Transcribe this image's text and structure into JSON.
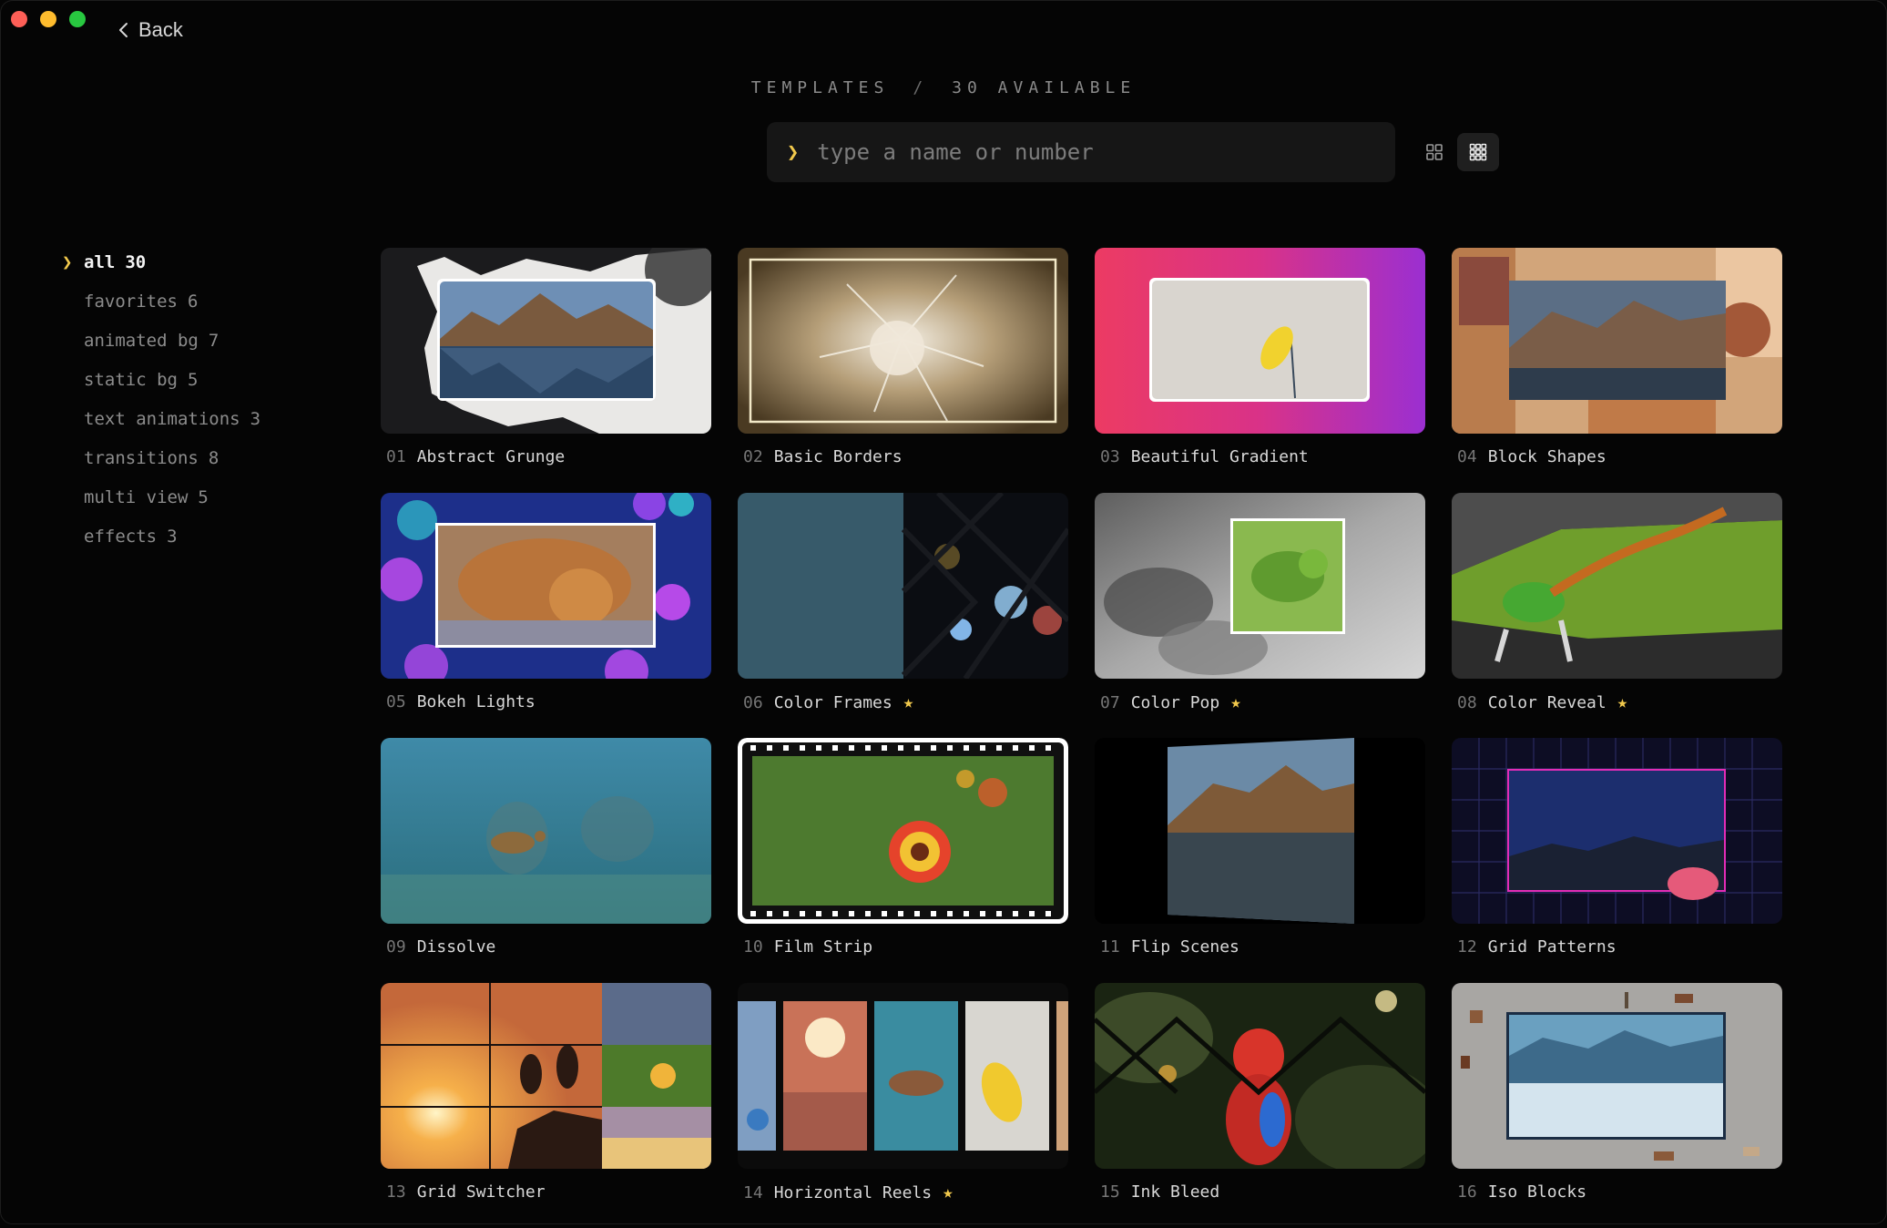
{
  "window": {
    "back_label": "Back"
  },
  "header": {
    "title": "TEMPLATES",
    "separator": "/",
    "available": "30 AVAILABLE"
  },
  "search": {
    "prompt_glyph": "❯",
    "placeholder": "type a name or number"
  },
  "view_toggle": {
    "options": [
      "grid-2x2-icon",
      "grid-3x3-icon"
    ],
    "selected": "grid-3x3-icon"
  },
  "sidebar": {
    "active_glyph": "❯",
    "items": [
      {
        "label": "all",
        "count": "30",
        "active": true
      },
      {
        "label": "favorites",
        "count": "6"
      },
      {
        "label": "animated bg",
        "count": "7"
      },
      {
        "label": "static bg",
        "count": "5"
      },
      {
        "label": "text animations",
        "count": "3"
      },
      {
        "label": "transitions",
        "count": "8"
      },
      {
        "label": "multi view",
        "count": "5"
      },
      {
        "label": "effects",
        "count": "3"
      }
    ]
  },
  "templates": [
    {
      "num": "01",
      "name": "Abstract Grunge",
      "favorite": false
    },
    {
      "num": "02",
      "name": "Basic Borders",
      "favorite": false
    },
    {
      "num": "03",
      "name": "Beautiful Gradient",
      "favorite": false
    },
    {
      "num": "04",
      "name": "Block Shapes",
      "favorite": false
    },
    {
      "num": "05",
      "name": "Bokeh Lights",
      "favorite": false
    },
    {
      "num": "06",
      "name": "Color Frames",
      "favorite": true
    },
    {
      "num": "07",
      "name": "Color Pop",
      "favorite": true
    },
    {
      "num": "08",
      "name": "Color Reveal",
      "favorite": true
    },
    {
      "num": "09",
      "name": "Dissolve",
      "favorite": false
    },
    {
      "num": "10",
      "name": "Film Strip",
      "favorite": false
    },
    {
      "num": "11",
      "name": "Flip Scenes",
      "favorite": false
    },
    {
      "num": "12",
      "name": "Grid Patterns",
      "favorite": false
    },
    {
      "num": "13",
      "name": "Grid Switcher",
      "favorite": false
    },
    {
      "num": "14",
      "name": "Horizontal Reels",
      "favorite": true
    },
    {
      "num": "15",
      "name": "Ink Bleed",
      "favorite": false
    },
    {
      "num": "16",
      "name": "Iso Blocks",
      "favorite": false
    }
  ],
  "colors": {
    "accent": "#f2c94c",
    "background": "#050505",
    "search_bg": "#161616"
  },
  "icons": {
    "favorite": "star-icon",
    "back": "chevron-left-icon"
  }
}
